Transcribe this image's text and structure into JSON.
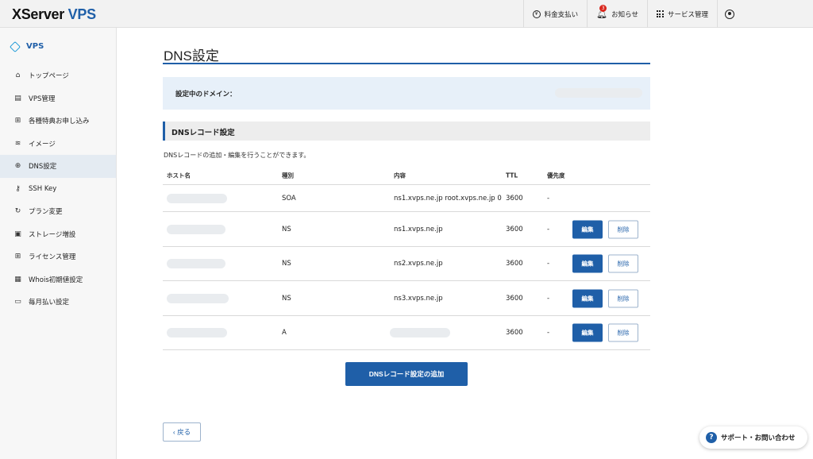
{
  "header": {
    "logo_main": "XServer",
    "logo_accent": "VPS",
    "nav": {
      "billing": "料金支払い",
      "notifications": "お知らせ",
      "notification_count": "3",
      "services": "サービス管理"
    }
  },
  "sidebar": {
    "title": "VPS",
    "items": [
      {
        "label": "トップページ",
        "icon": "home-icon"
      },
      {
        "label": "VPS管理",
        "icon": "server-icon"
      },
      {
        "label": "各種特典お申し込み",
        "icon": "gift-icon"
      },
      {
        "label": "イメージ",
        "icon": "layers-icon"
      },
      {
        "label": "DNS設定",
        "icon": "globe-icon"
      },
      {
        "label": "SSH Key",
        "icon": "key-icon"
      },
      {
        "label": "プラン変更",
        "icon": "refresh-icon"
      },
      {
        "label": "ストレージ増設",
        "icon": "storage-icon"
      },
      {
        "label": "ライセンス管理",
        "icon": "windows-icon"
      },
      {
        "label": "Whois初期値設定",
        "icon": "document-icon"
      },
      {
        "label": "毎月払い設定",
        "icon": "card-icon"
      }
    ],
    "active_index": 4
  },
  "main": {
    "page_title": "DNS設定",
    "domain_label": "設定中のドメイン：",
    "section_title": "DNSレコード設定",
    "description": "DNSレコードの追加・編集を行うことができます。",
    "table": {
      "headers": {
        "host": "ホスト名",
        "type": "種別",
        "content": "内容",
        "ttl": "TTL",
        "priority": "優先度"
      },
      "rows": [
        {
          "type": "SOA",
          "content": "ns1.xvps.ne.jp root.xvps.ne.jp 0",
          "ttl": "3600",
          "priority": "-",
          "editable": false
        },
        {
          "type": "NS",
          "content": "ns1.xvps.ne.jp",
          "ttl": "3600",
          "priority": "-",
          "editable": true
        },
        {
          "type": "NS",
          "content": "ns2.xvps.ne.jp",
          "ttl": "3600",
          "priority": "-",
          "editable": true
        },
        {
          "type": "NS",
          "content": "ns3.xvps.ne.jp",
          "ttl": "3600",
          "priority": "-",
          "editable": true
        },
        {
          "type": "A",
          "content": "",
          "ttl": "3600",
          "priority": "-",
          "editable": true
        }
      ],
      "edit_label": "編集",
      "delete_label": "削除"
    },
    "add_button": "DNSレコード設定の追加",
    "back_button": "‹ 戻る"
  },
  "support": {
    "label": "サポート・お問い合わせ"
  },
  "colors": {
    "brand": "#1f5fa8",
    "accent": "#1f9bd8",
    "badge": "#d9261c"
  }
}
